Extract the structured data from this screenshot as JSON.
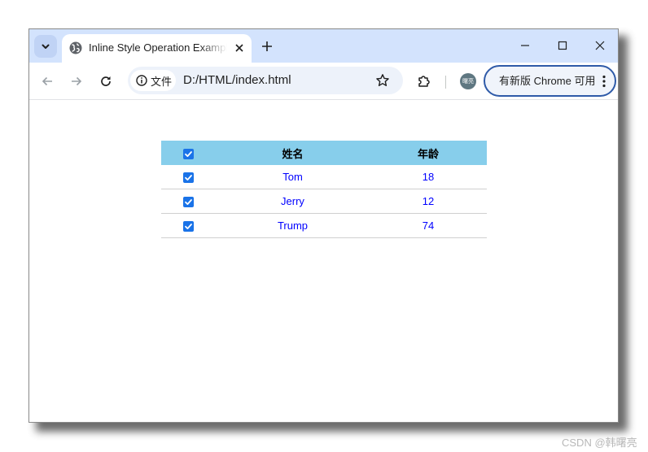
{
  "browser": {
    "tab": {
      "title": "Inline Style Operation Example"
    },
    "address": {
      "security_label": "文件",
      "url": "D:/HTML/index.html"
    },
    "profile": {
      "avatar_text": "曙亮"
    },
    "update_button": {
      "label": "有新版 Chrome 可用"
    }
  },
  "page": {
    "table": {
      "headers": {
        "name": "姓名",
        "age": "年龄"
      },
      "header_checked": true,
      "header_bg": "#87ceeb",
      "cell_text_color": "#0000ff",
      "rows": [
        {
          "name": "Tom",
          "age": "18",
          "checked": true
        },
        {
          "name": "Jerry",
          "age": "12",
          "checked": true
        },
        {
          "name": "Trump",
          "age": "74",
          "checked": true
        }
      ]
    }
  },
  "watermark": "CSDN @韩曙亮",
  "icons": {
    "tab_search": "chevron-down-icon",
    "favicon": "globe-icon",
    "tab_close": "close-icon",
    "new_tab": "plus-icon",
    "back": "arrow-left-icon",
    "forward": "arrow-right-icon",
    "reload": "reload-icon",
    "info": "info-icon",
    "bookmark": "star-icon",
    "extensions": "puzzle-icon",
    "menu": "kebab-menu-icon",
    "minimize": "minimize-icon",
    "maximize": "maximize-icon",
    "close_window": "close-icon"
  }
}
